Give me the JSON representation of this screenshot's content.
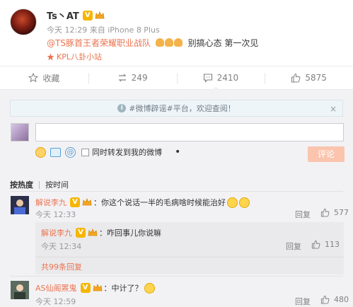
{
  "post": {
    "username": "Ts丶AT",
    "verified_badge": "V",
    "meta": "今天 12:29 来自 iPhone 8 Plus",
    "mention": "@TS豚首王者荣耀职业战队",
    "text": "别搞心态  第一次见",
    "source": "KPL八卦小站",
    "source_icon": "pin-icon"
  },
  "actions": {
    "favorite_label": "收藏",
    "repost_count": "249",
    "comment_count": "2410",
    "like_count": "5875"
  },
  "notice": {
    "text": "#微博辟谣#平台，欢迎查阅！",
    "close_glyph": "×"
  },
  "composer": {
    "input_placeholder": "",
    "repost_checkbox_label": "同时转发到我的微博",
    "submit_label": "评论"
  },
  "sort": {
    "hot_label": "按热度",
    "time_label": "按时间"
  },
  "comments": [
    {
      "name": "解说李九",
      "badge": "V",
      "text": "：你这个说话一半的毛病啥时候能治好",
      "time": "今天 12:33",
      "reply_label": "回复",
      "likes": "577",
      "sub_comments": [
        {
          "name": "解说李九",
          "badge": "V",
          "text": "：咋回事儿你说嘛",
          "time": "今天 12:34",
          "reply_label": "回复",
          "likes": "113"
        }
      ],
      "more_replies": "共99条回复"
    },
    {
      "name": "AS仙阁罴鬼",
      "badge": "V",
      "text": "：中计了？",
      "time": "今天 12:59",
      "reply_label": "回复",
      "likes": "480"
    }
  ],
  "colors": {
    "accent": "#eb7350",
    "submit_disabled": "#fbc4ad",
    "badge_gold": "#f7b500",
    "panel_bg": "#f2f2f5"
  }
}
